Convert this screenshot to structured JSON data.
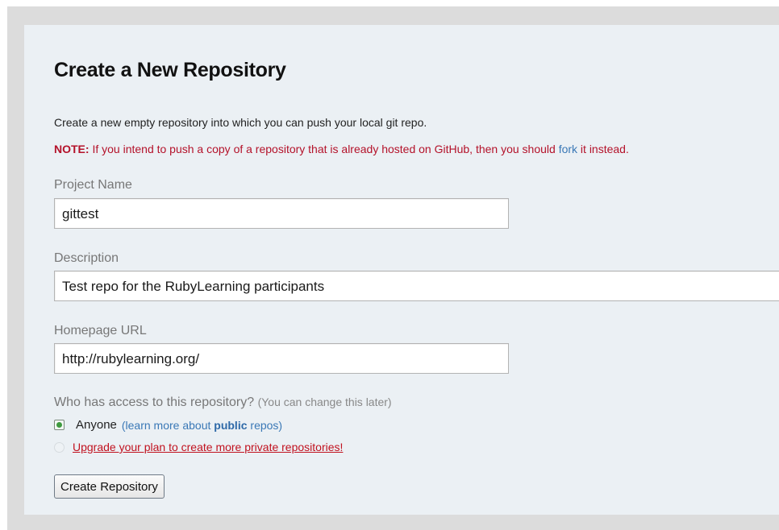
{
  "page": {
    "title": "Create a New Repository",
    "intro": "Create a new empty repository into which you can push your local git repo.",
    "note": {
      "prefix": "NOTE:",
      "text_before": " If you intend to push a copy of a repository that is already hosted on GitHub, then you should ",
      "fork_link": "fork",
      "text_after": " it instead."
    }
  },
  "form": {
    "project_name": {
      "label": "Project Name",
      "value": "gittest"
    },
    "description": {
      "label": "Description",
      "value": "Test repo for the RubyLearning participants"
    },
    "homepage": {
      "label": "Homepage URL",
      "value": "http://rubylearning.org/"
    },
    "access": {
      "question": "Who has access to this repository?",
      "hint": "(You can change this later)",
      "anyone_label": "Anyone",
      "learn_more_prefix": "(learn more about ",
      "learn_more_bold": "public",
      "learn_more_suffix": " repos)",
      "upgrade_link": "Upgrade your plan to create more private repositories!"
    },
    "submit_label": "Create Repository"
  },
  "colors": {
    "panel_bg": "#ebf0f4",
    "note_red": "#b4122a",
    "link_blue": "#3a78b6"
  }
}
